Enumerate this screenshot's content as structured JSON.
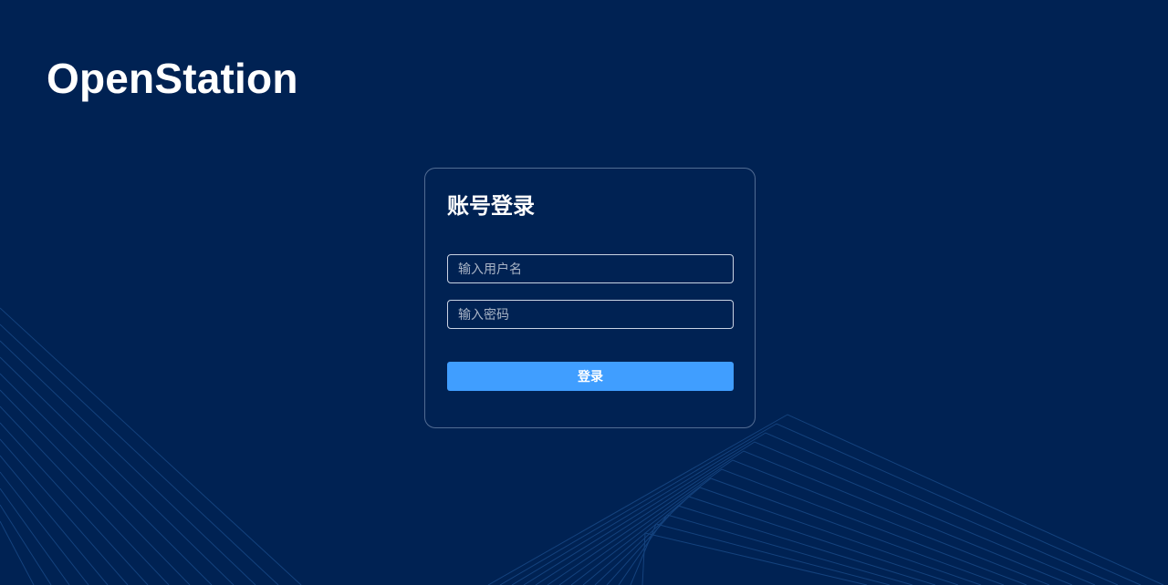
{
  "brand": {
    "name": "OpenStation"
  },
  "login": {
    "title": "账号登录",
    "username_placeholder": "输入用户名",
    "password_placeholder": "输入密码",
    "submit_label": "登录"
  },
  "colors": {
    "background": "#002253",
    "accent": "#409eff",
    "field_border": "#c9d3e3",
    "decorative_lines": "#1b4d8c"
  }
}
